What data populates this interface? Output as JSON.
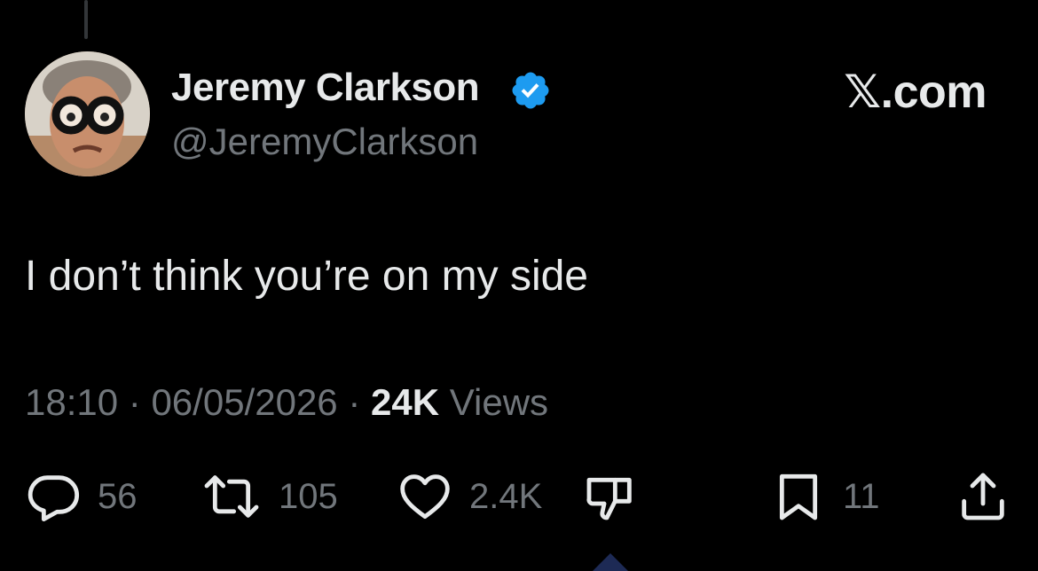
{
  "author": {
    "display_name": "Jeremy Clarkson",
    "handle": "@JeremyClarkson",
    "verified": true
  },
  "brand": "𝕏.com",
  "tweet": {
    "text": "I don’t think you’re on my side",
    "time": "18:10",
    "separator": "·",
    "date": "06/05/2026",
    "views_count": "24K",
    "views_label": "Views"
  },
  "actions": {
    "replies": "56",
    "reposts": "105",
    "likes": "2.4K",
    "bookmarks": "11"
  },
  "colors": {
    "background": "#000000",
    "primary_text": "#e7e9ea",
    "secondary_text": "#71767b",
    "verified_badge": "#1d9bf0"
  },
  "icons": [
    "verified-badge-icon",
    "reply-icon",
    "repost-icon",
    "like-icon",
    "dislike-icon",
    "bookmark-icon",
    "share-icon"
  ]
}
